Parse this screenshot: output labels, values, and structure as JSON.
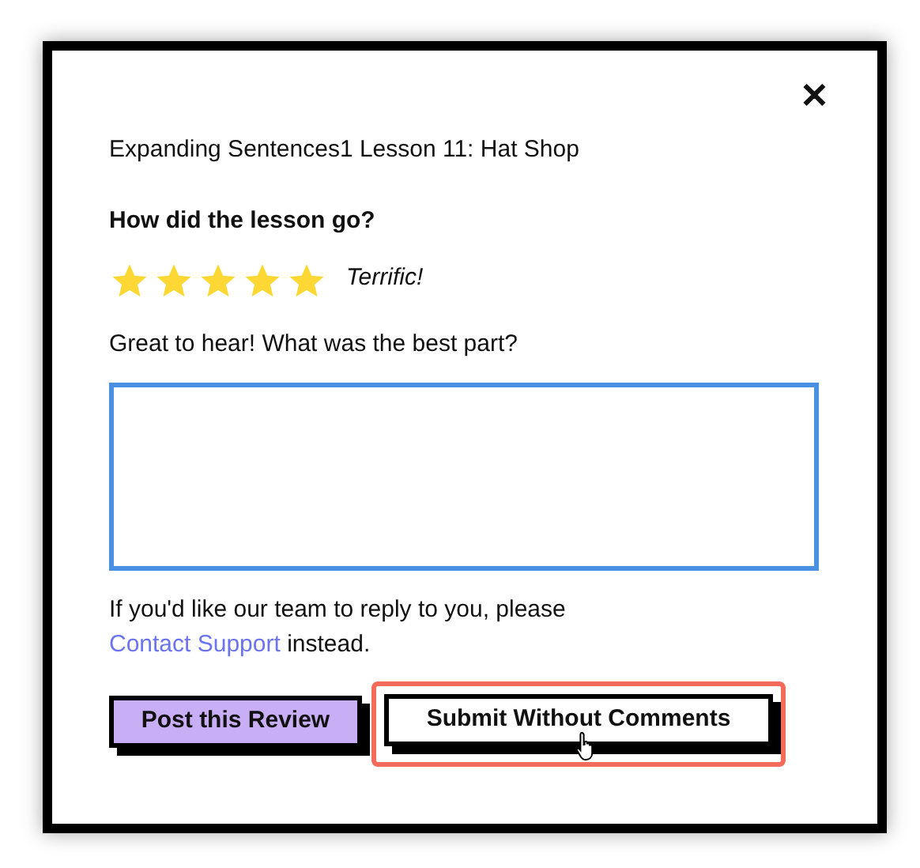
{
  "dialog": {
    "close_label": "✕",
    "lesson_title": "Expanding Sentences1 Lesson 11: Hat Shop",
    "question": "How did the lesson go?",
    "rating": {
      "stars": 5,
      "caption": "Terrific!"
    },
    "comment_prompt": "Great to hear! What was the best part?",
    "note": {
      "before": "If you'd like our team to reply to you, please ",
      "link": "Contact Support",
      "after": " instead."
    },
    "buttons": [
      {
        "label": "Post this Review",
        "kind": "primary",
        "highlighted": false
      },
      {
        "label": "Submit Without Comments",
        "kind": "secondary",
        "highlighted": true
      }
    ]
  }
}
